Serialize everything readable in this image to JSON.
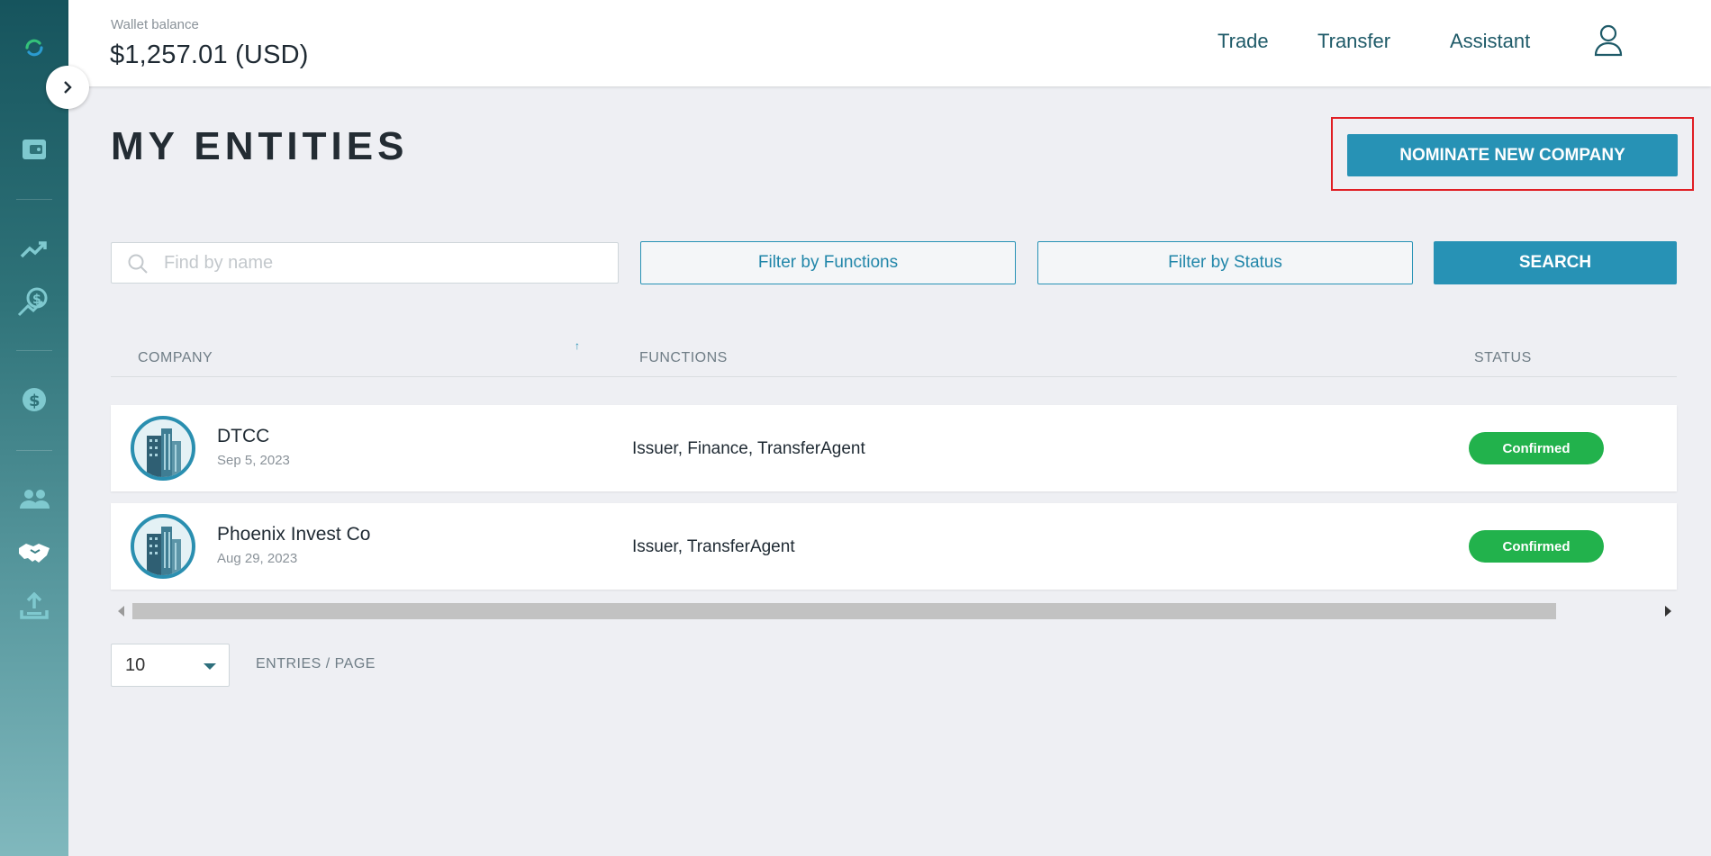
{
  "header": {
    "wallet_label": "Wallet balance",
    "wallet_value": "$1,257.01 (USD)",
    "nav": [
      "Trade",
      "Transfer",
      "Assistant"
    ]
  },
  "sidebar": {
    "icons": [
      "refresh-logo-icon",
      "wallet-icon",
      "trend-up-icon",
      "investment-icon",
      "dollar-icon",
      "users-icon",
      "handshake-icon",
      "upload-icon"
    ],
    "active": "handshake-icon"
  },
  "page": {
    "title": "MY ENTITIES",
    "nominate_label": "NOMINATE NEW COMPANY"
  },
  "filters": {
    "search_placeholder": "Find by name",
    "functions_label": "Filter by Functions",
    "status_label": "Filter by Status",
    "search_label": "SEARCH"
  },
  "table": {
    "columns": [
      "COMPANY",
      "FUNCTIONS",
      "STATUS"
    ],
    "sort_indicator": "↑",
    "rows": [
      {
        "name": "DTCC",
        "date": "Sep 5, 2023",
        "functions": "Issuer, Finance, TransferAgent",
        "status": "Confirmed"
      },
      {
        "name": "Phoenix Invest Co",
        "date": "Aug 29, 2023",
        "functions": "Issuer, TransferAgent",
        "status": "Confirmed"
      }
    ]
  },
  "pagination": {
    "per_page": "10",
    "label": "ENTRIES / PAGE"
  },
  "colors": {
    "accent": "#2792b5",
    "status_confirmed": "#22b24c",
    "highlight": "#e01e24"
  }
}
